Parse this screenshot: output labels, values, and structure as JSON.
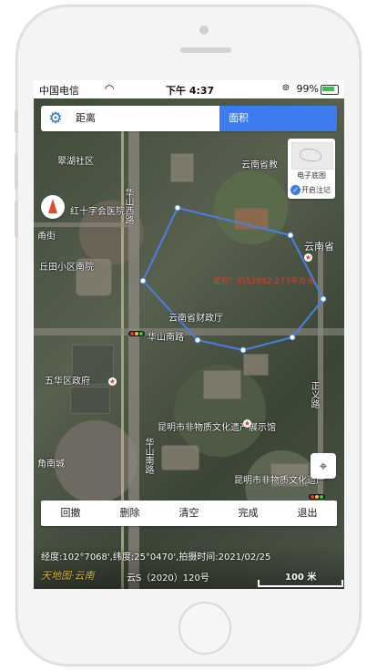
{
  "status_bar": {
    "carrier": "中国电信",
    "time": "下午 4:37",
    "battery": "99%"
  },
  "tabs": {
    "distance_label": "距离",
    "area_label": "面积"
  },
  "basemap": {
    "label": "电子底图",
    "annotation_label": "开启注记"
  },
  "map_labels": [
    "翠湖社区",
    "云南省教",
    "华山西路",
    "红十字会医院",
    "云南省",
    "甬街",
    "丘田小区南院",
    "云南省财政厅",
    "华山南路",
    "五华区政府",
    "昆明市非物质文化遗产展示馆",
    "华山南路",
    "角南城",
    "昆明市非物质文化遗产",
    "正义路"
  ],
  "area_label": "面积：约52882.273平方米",
  "actions": {
    "undo": "回撤",
    "delete": "删除",
    "clear": "清空",
    "done": "完成",
    "exit": "退出"
  },
  "info": {
    "coordinates": "经度:102°7068',纬度:25°0470',拍摄时间:2021/02/25",
    "logo": "天地图·云南",
    "permit": "云S（2020）120号",
    "scale": "100 米"
  },
  "colors": {
    "accent": "#3d7bf0",
    "polygon": "#4a7fe6",
    "area_text": "#e03a2a"
  }
}
